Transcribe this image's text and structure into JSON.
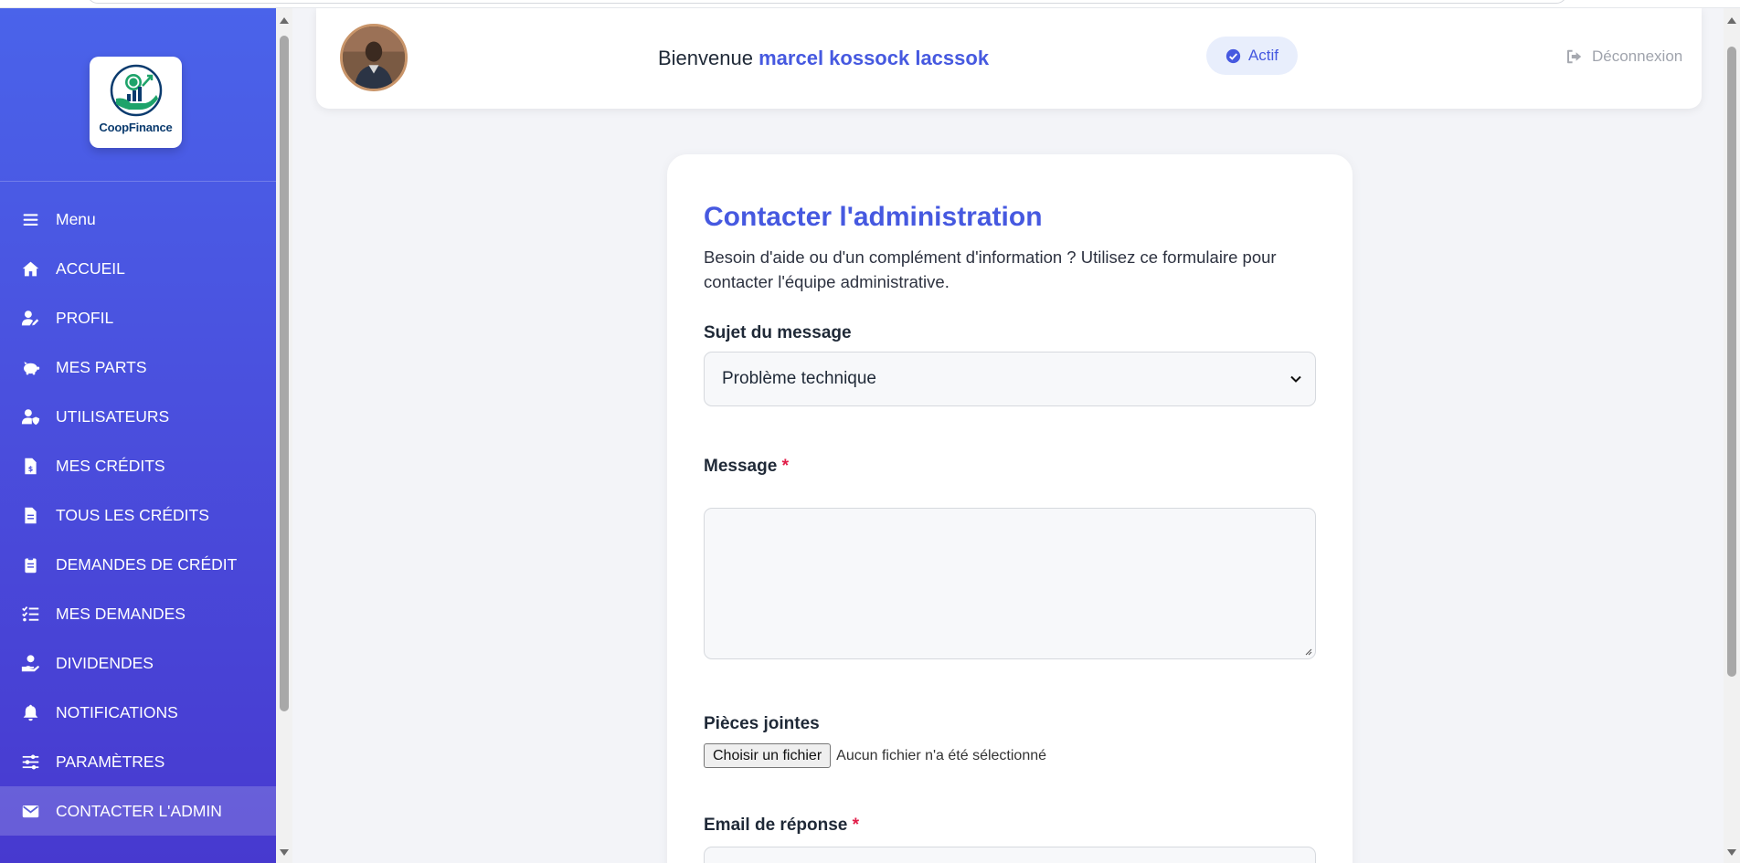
{
  "app": {
    "logo_text": "CoopFinance"
  },
  "sidebar": {
    "items": [
      {
        "label": "Menu",
        "icon": "bars-icon"
      },
      {
        "label": "ACCUEIL",
        "icon": "home-icon"
      },
      {
        "label": "PROFIL",
        "icon": "user-edit-icon"
      },
      {
        "label": "MES PARTS",
        "icon": "piggy-bank-icon"
      },
      {
        "label": "UTILISATEURS",
        "icon": "user-shield-icon"
      },
      {
        "label": "MES CRÉDITS",
        "icon": "file-invoice-dollar-icon"
      },
      {
        "label": "TOUS LES CRÉDITS",
        "icon": "file-icon"
      },
      {
        "label": "DEMANDES DE CRÉDIT",
        "icon": "clipboard-icon"
      },
      {
        "label": "MES DEMANDES",
        "icon": "list-check-icon"
      },
      {
        "label": "DIVIDENDES",
        "icon": "hand-holding-dollar-icon"
      },
      {
        "label": "NOTIFICATIONS",
        "icon": "bell-icon"
      },
      {
        "label": "PARAMÈTRES",
        "icon": "sliders-icon"
      },
      {
        "label": "CONTACTER L'ADMIN",
        "icon": "envelope-icon",
        "active": true
      }
    ]
  },
  "header": {
    "welcome_prefix": "Bienvenue",
    "user_name": "marcel kossock lacssok",
    "status": "Actif",
    "logout": "Déconnexion"
  },
  "form": {
    "title": "Contacter l'administration",
    "intro": "Besoin d'aide ou d'un complément d'information ? Utilisez ce formulaire pour contacter l'équipe administrative.",
    "subject_label": "Sujet du message",
    "subject_value": "Problème technique",
    "message_label": "Message",
    "required_mark": "*",
    "message_value": "",
    "attachments_label": "Pièces jointes",
    "file_button": "Choisir un fichier",
    "file_status": "Aucun fichier n'a été sélectionné",
    "email_label": "Email de réponse"
  },
  "colors": {
    "accent": "#4659e0",
    "sidebar_top": "#4a63ea",
    "sidebar_bottom": "#4739cf",
    "required": "#e11d48",
    "background": "#f3f4f8"
  }
}
